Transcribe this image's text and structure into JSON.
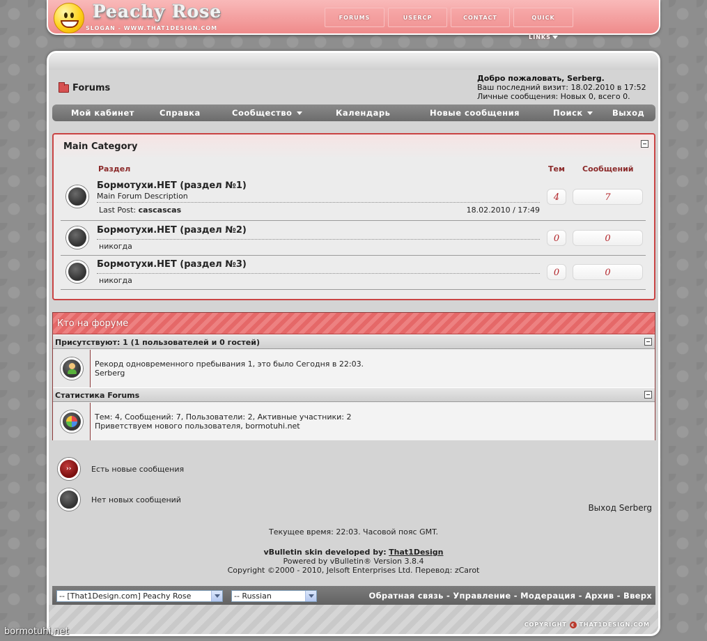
{
  "header": {
    "logo_title": "Peachy Rose",
    "logo_slogan": "SLOGAN - WWW.THAT1DESIGN.COM",
    "nav": [
      "FORUMS",
      "USERCP",
      "CONTACT",
      "QUICK LINKS"
    ]
  },
  "breadcrumb": {
    "title": "Forums"
  },
  "welcome": {
    "greeting": "Добро пожаловать, Serberg.",
    "last_visit": "Ваш последний визит: 18.02.2010 в 17:52",
    "pm": "Личные сообщения: Новых 0, всего 0."
  },
  "navbar": {
    "items": [
      "Мой кабинет",
      "Справка",
      "Сообщество",
      "Календарь",
      "Новые сообщения",
      "Поиск",
      "Выход"
    ]
  },
  "category": {
    "title": "Main Category",
    "col_section": "Раздел",
    "col_threads": "Тем",
    "col_posts": "Сообщений",
    "forums": [
      {
        "name": "Бормотухи.НЕТ (раздел №1)",
        "description": "Main Forum Description",
        "last_post_label": "Last Post:",
        "last_post_title": "cascascas",
        "last_post_date": "18.02.2010 / 17:49",
        "threads": "4",
        "posts": "7"
      },
      {
        "name": "Бормотухи.НЕТ (раздел №2)",
        "last_post_text": "никогда",
        "threads": "0",
        "posts": "0"
      },
      {
        "name": "Бормотухи.НЕТ (раздел №3)",
        "last_post_text": "никогда",
        "threads": "0",
        "posts": "0"
      }
    ]
  },
  "whos_online": {
    "title": "Кто на форуме",
    "present_header": "Присутствуют: 1 (1 пользователей и 0 гостей)",
    "record_text": "Рекорд одновременного пребывания 1, это было Сегодня в 22:03.",
    "users": "Serberg",
    "stats_header": "Статистика Forums",
    "stats_text": "Тем: 4, Сообщений: 7, Пользователи: 2, Активные участники: 2",
    "newest_member": "Приветствуем нового пользователя, bormotuhi.net"
  },
  "legend": {
    "new_posts": "Есть новые сообщения",
    "no_new_posts": "Нет новых сообщений"
  },
  "logout_text": "Выход Serberg",
  "footer": {
    "current_time": "Текущее время: 22:03. Часовой пояс GMT.",
    "skin_label": "vBulletin skin developed by:",
    "skin_author": "That1Design",
    "powered_by": "Powered by vBulletin® Version 3.8.4",
    "copyright": "Copyright ©2000 - 2010, Jelsoft Enterprises Ltd. Перевод: zCarot",
    "style_select": "-- [That1Design.com] Peachy Rose",
    "language_select": "-- Russian",
    "links": "Обратная связь - Управление - Модерация - Архив - Вверх",
    "bottom_copyright_left": "COPYRIGHT",
    "bottom_copyright_right": "THAT1DESIGN.COM"
  },
  "watermark": "bormotuhi.net",
  "colors": {
    "accent": "#ef8b8b",
    "category_border": "#c94343",
    "count_text": "#b3262b",
    "navbar": "#6c6c6c"
  }
}
